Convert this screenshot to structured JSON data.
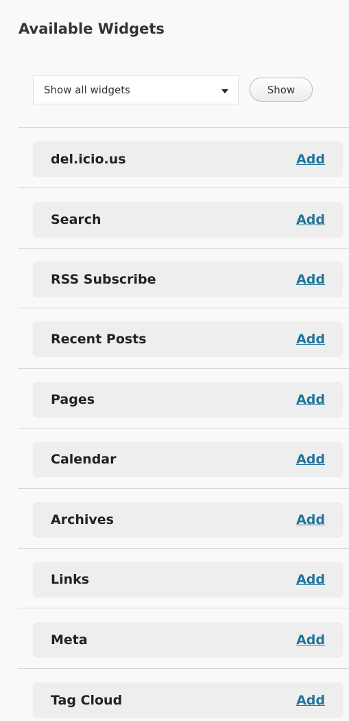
{
  "title": "Available Widgets",
  "filter": {
    "selected": "Show all widgets",
    "show_label": "Show"
  },
  "widgets": [
    {
      "name": "del.icio.us",
      "action": "Add"
    },
    {
      "name": "Search",
      "action": "Add"
    },
    {
      "name": "RSS Subscribe",
      "action": "Add"
    },
    {
      "name": "Recent Posts",
      "action": "Add"
    },
    {
      "name": "Pages",
      "action": "Add"
    },
    {
      "name": "Calendar",
      "action": "Add"
    },
    {
      "name": "Archives",
      "action": "Add"
    },
    {
      "name": "Links",
      "action": "Add"
    },
    {
      "name": "Meta",
      "action": "Add"
    },
    {
      "name": "Tag Cloud",
      "action": "Add"
    }
  ],
  "colors": {
    "link": "#21759b",
    "panel_background": "#f9f9f9",
    "widget_background": "#eeeeee"
  }
}
